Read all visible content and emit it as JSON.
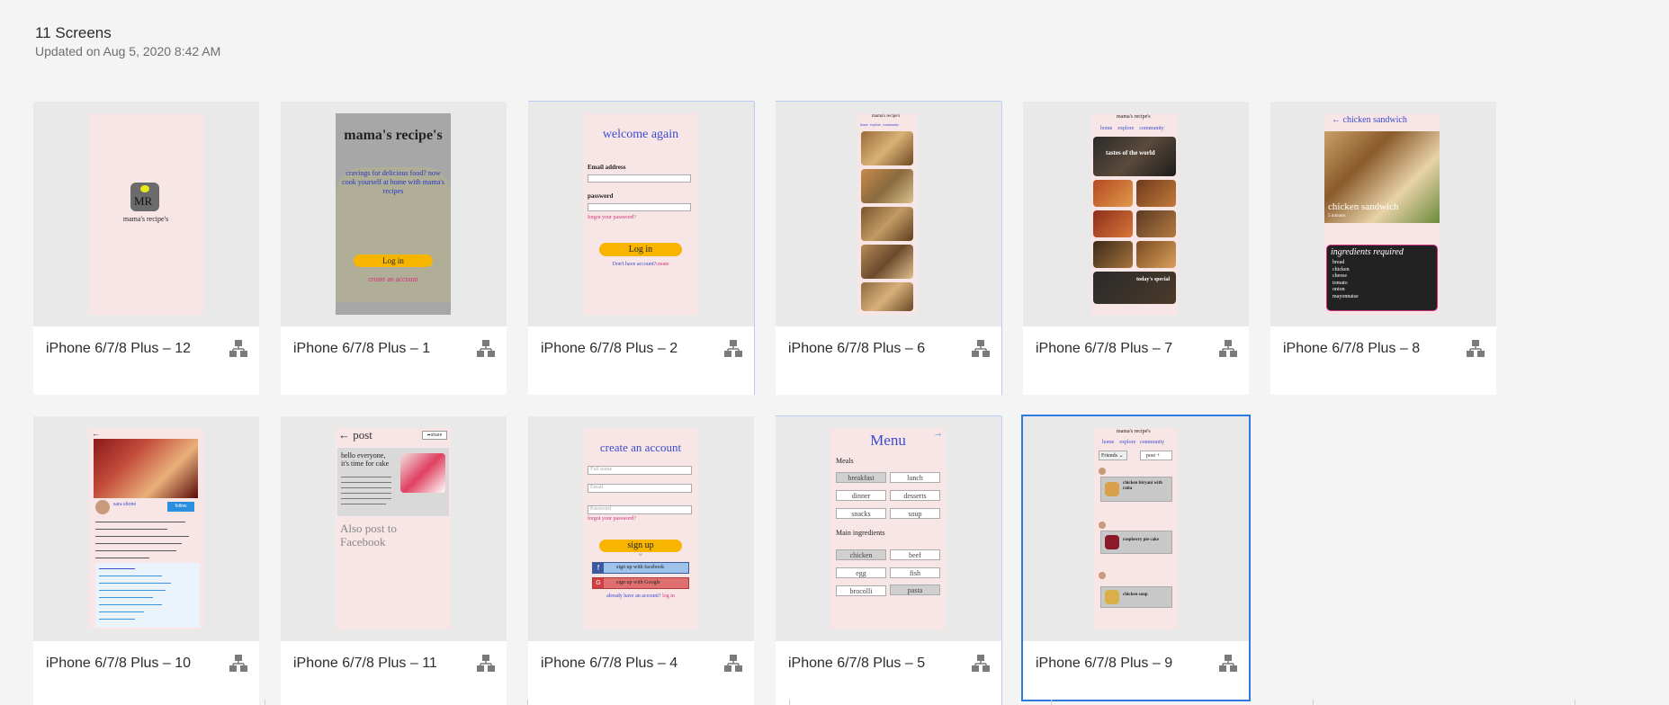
{
  "header": {
    "title": "11 Screens",
    "updated": "Updated on Aug 5, 2020 8:42 AM"
  },
  "screens": [
    {
      "name": "iPhone 6/7/8 Plus – 12"
    },
    {
      "name": "iPhone 6/7/8 Plus – 1"
    },
    {
      "name": "iPhone 6/7/8 Plus – 2"
    },
    {
      "name": "iPhone 6/7/8 Plus – 6"
    },
    {
      "name": "iPhone 6/7/8 Plus – 7"
    },
    {
      "name": "iPhone 6/7/8 Plus – 8"
    },
    {
      "name": "iPhone 6/7/8 Plus – 10"
    },
    {
      "name": "iPhone 6/7/8 Plus – 11"
    },
    {
      "name": "iPhone 6/7/8 Plus – 4"
    },
    {
      "name": "iPhone 6/7/8 Plus – 5"
    },
    {
      "name": "iPhone 6/7/8 Plus – 9"
    }
  ],
  "thumbs": {
    "s12": {
      "logo": "MR",
      "brand": "mama's recipe's"
    },
    "s1": {
      "title": "mama's recipe's",
      "tagline": "cravings for delicious food? now cook yourself at home with mama's recipes",
      "login": "Log in",
      "create": "create an account"
    },
    "s2": {
      "welcome": "welcome again",
      "email_label": "Email address",
      "password_label": "password",
      "forgot": "forgot your password?",
      "login": "Log in",
      "no_account": "Don't have account?",
      "create": "create"
    },
    "s6": {
      "brand": "mama's recipe's",
      "tabs": [
        "home",
        "explore",
        "community"
      ]
    },
    "s7": {
      "brand": "mama's recipe's",
      "tabs": [
        "home",
        "explore",
        "community"
      ],
      "banner": "tastes of the world",
      "special": "today's special"
    },
    "s8": {
      "title": "chicken sandwich",
      "dish": "chicken sandwich",
      "servings": "5 minutes",
      "ing_title": "ingredients required",
      "ingredients": [
        "bread",
        "chicken",
        "cheese",
        "tomato",
        "onion",
        "mayonnaise"
      ]
    },
    "s10": {
      "user": "sara shone",
      "follow": "follow"
    },
    "s11": {
      "title": "post",
      "share": "share",
      "message": "hello everyone, it's time for cake",
      "fb": "Also post to Facebook"
    },
    "s4": {
      "title": "create an account",
      "full_name": "Full name",
      "email": "Email",
      "password": "Password",
      "forgot": "forgot your password?",
      "signup": "sign up",
      "or": "or",
      "facebook": "sign up with facebook",
      "google": "sign up with Google",
      "have_account": "already have an account?",
      "login": "log in"
    },
    "s5": {
      "title": "Menu",
      "meals_label": "Meals",
      "meals": [
        "breakfast",
        "lunch",
        "dinner",
        "desserts",
        "snacks",
        "soup"
      ],
      "main_label": "Main ingredients",
      "mains": [
        "chicken",
        "beef",
        "egg",
        "fish",
        "brocolli",
        "pasta"
      ]
    },
    "s9": {
      "brand": "mama's recipe's",
      "tabs": [
        "home",
        "explore",
        "community"
      ],
      "friends": "Friends",
      "post": "post",
      "posts": [
        "chicken biryani with raita",
        "raspberry pie cake",
        "chicken soup"
      ]
    }
  },
  "colors": {
    "accent": "#2d7be0",
    "pink": "#f8e6e6",
    "yellow": "#f7b500"
  }
}
